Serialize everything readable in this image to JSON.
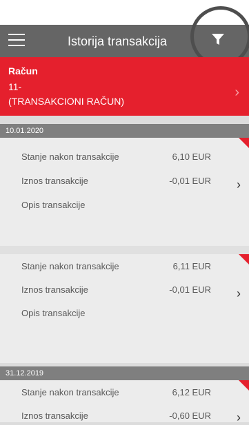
{
  "header": {
    "title": "Istorija transakcija",
    "menu_icon": "hamburger-icon",
    "filter_icon": "filter-icon"
  },
  "account": {
    "label": "Račun",
    "number": "11-",
    "name": "(TRANSAKCIONI RAČUN)"
  },
  "groups": [
    {
      "date": "10.01.2020",
      "transactions": [
        {
          "balance_label": "Stanje nakon transakcije",
          "balance_value": "6,10 EUR",
          "amount_label": "Iznos transakcije",
          "amount_value": "-0,01 EUR",
          "desc_label": "Opis transakcije"
        },
        {
          "balance_label": "Stanje nakon transakcije",
          "balance_value": "6,11 EUR",
          "amount_label": "Iznos transakcije",
          "amount_value": "-0,01 EUR",
          "desc_label": "Opis transakcije"
        }
      ]
    },
    {
      "date": "31.12.2019",
      "transactions": [
        {
          "balance_label": "Stanje nakon transakcije",
          "balance_value": "6,12 EUR",
          "amount_label": "Iznos transakcije",
          "amount_value": "-0,60 EUR"
        }
      ]
    }
  ],
  "colors": {
    "accent": "#e5202d",
    "header": "#656565",
    "date_bar": "#7f7f7f"
  }
}
